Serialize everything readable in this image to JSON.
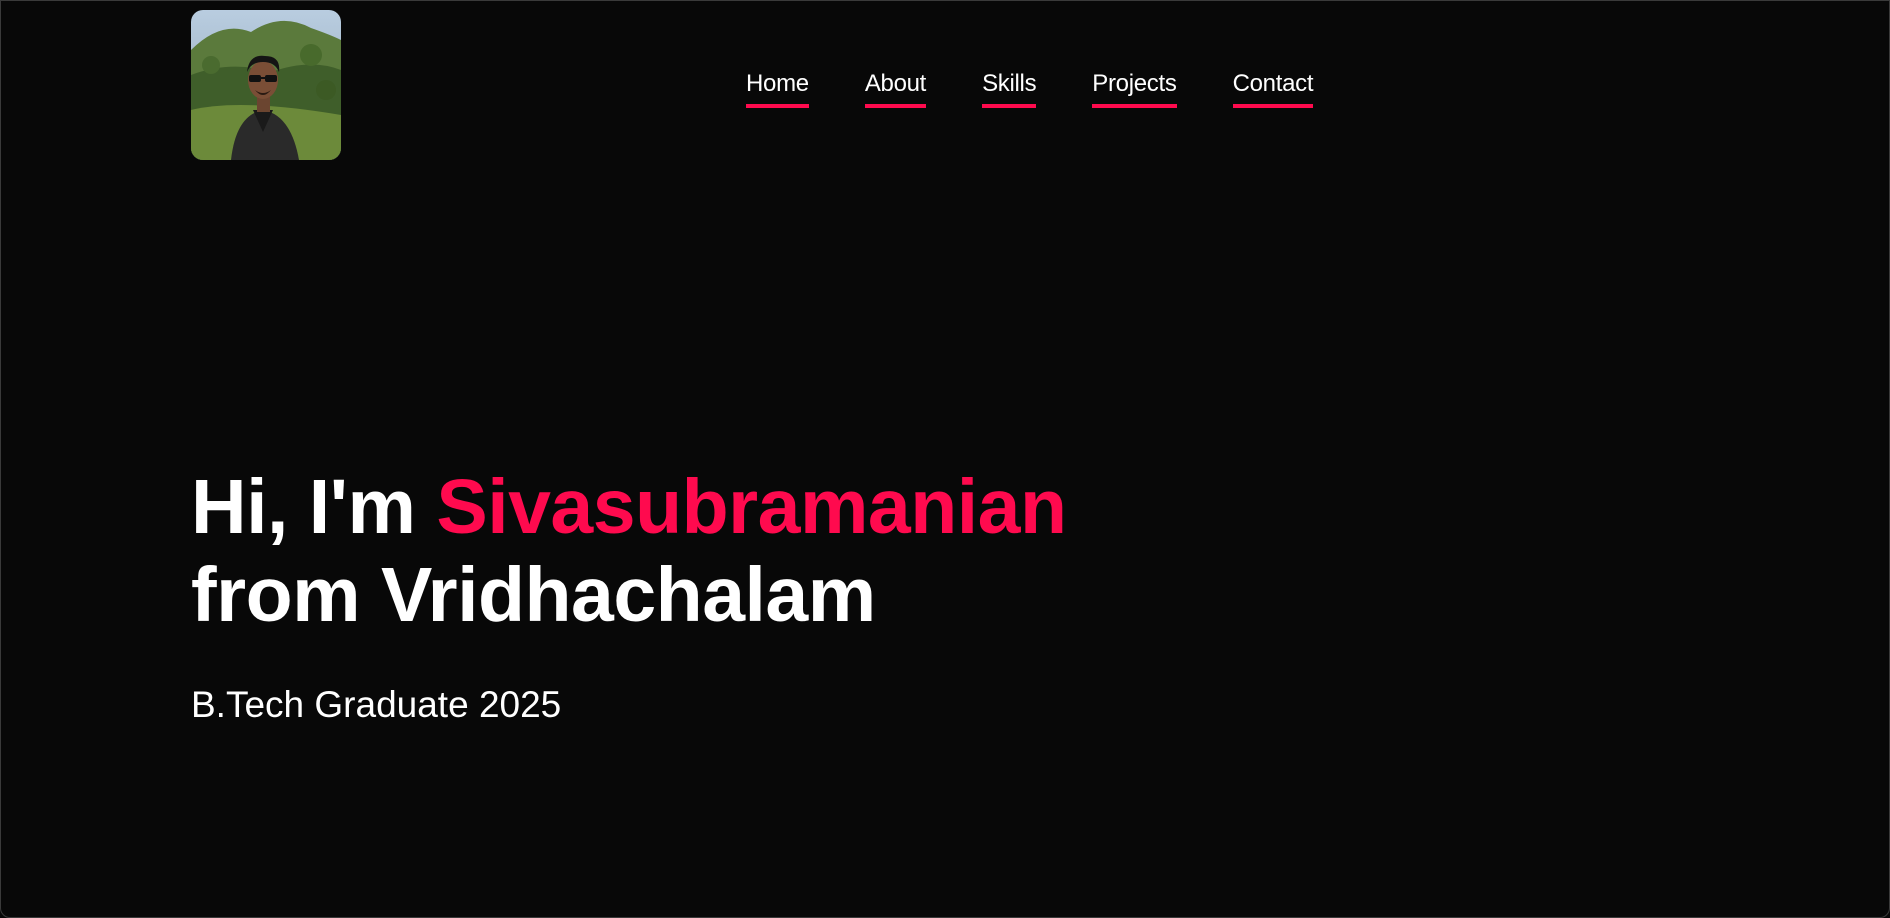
{
  "profile": {
    "avatar_icon": "profile-photo"
  },
  "nav": {
    "items": [
      {
        "label": "Home"
      },
      {
        "label": "About"
      },
      {
        "label": "Skills"
      },
      {
        "label": "Projects"
      },
      {
        "label": "Contact"
      }
    ]
  },
  "hero": {
    "greeting": "Hi, I'm ",
    "name": "Sivasubramanian",
    "location_line": "from Vridhachalam",
    "subtitle": "B.Tech Graduate 2025"
  },
  "colors": {
    "background": "#080808",
    "accent": "#ff0a4e",
    "text": "#ffffff"
  }
}
